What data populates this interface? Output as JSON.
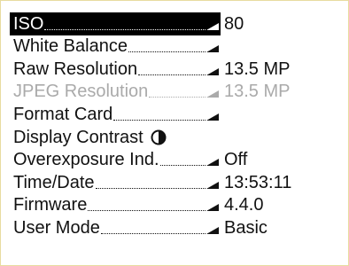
{
  "menu": {
    "items": [
      {
        "label": "ISO",
        "value": "80",
        "selected": true,
        "disabled": false
      },
      {
        "label": "White Balance",
        "value": "",
        "selected": false,
        "disabled": false
      },
      {
        "label": "Raw Resolution",
        "value": "13.5 MP",
        "selected": false,
        "disabled": false
      },
      {
        "label": "JPEG Resolution",
        "value": "13.5 MP",
        "selected": false,
        "disabled": true
      },
      {
        "label": "Format Card",
        "value": "",
        "selected": false,
        "disabled": false
      },
      {
        "label": "Display Contrast",
        "value": "",
        "selected": false,
        "disabled": false,
        "icon": "contrast-icon"
      },
      {
        "label": "Overexposure Ind.",
        "value": "Off",
        "selected": false,
        "disabled": false
      },
      {
        "label": "Time/Date",
        "value": "13:53:11",
        "selected": false,
        "disabled": false
      },
      {
        "label": "Firmware",
        "value": "4.4.0",
        "selected": false,
        "disabled": false
      },
      {
        "label": "User Mode",
        "value": "Basic",
        "selected": false,
        "disabled": false
      }
    ]
  },
  "colors": {
    "selected_background": "#000000",
    "selected_text": "#ffffff",
    "text": "#111111",
    "disabled_text": "#aaaaaa",
    "border": "#e8dca0"
  }
}
